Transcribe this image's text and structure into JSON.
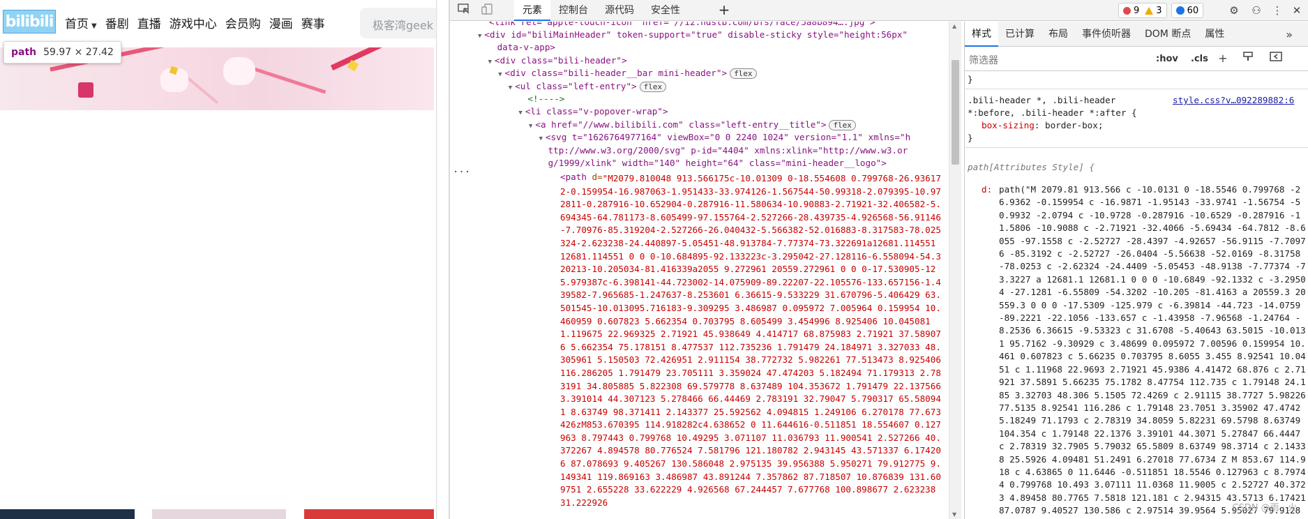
{
  "site": {
    "logo_text": "bilibili",
    "nav": [
      {
        "label": "首页",
        "has_dropdown": true
      },
      {
        "label": "番剧"
      },
      {
        "label": "直播"
      },
      {
        "label": "游戏中心"
      },
      {
        "label": "会员购"
      },
      {
        "label": "漫画"
      },
      {
        "label": "赛事"
      }
    ],
    "search_placeholder": "极客湾geek",
    "tooltip": {
      "tag": "path",
      "dims": "59.97 × 27.42"
    },
    "bottom_card_colors": [
      "#1e3046",
      "#f2e4ea",
      "#c8c8c8",
      "#e43b3b",
      "#f0d5c0"
    ]
  },
  "devtools": {
    "tabs": [
      "元素",
      "控制台",
      "源代码",
      "安全性"
    ],
    "active_tab": "元素",
    "errors": "9",
    "warnings": "3",
    "info": "60",
    "dom": {
      "top_fragment": "<link rel=\"apple-touch-icon\" href=\"//i2.hdslb.com/bfs/face/5a8b894….jpg\">",
      "lines": [
        {
          "indent": 0,
          "tri": "▼",
          "html": "<div id=\"biliMainHeader\" token-support=\"true\" disable-sticky style=\"height:56px\""
        },
        {
          "indent": 1,
          "tri": "",
          "html": "data-v-app>"
        },
        {
          "indent": 1,
          "tri": "▼",
          "html": "<div class=\"bili-header\">"
        },
        {
          "indent": 2,
          "tri": "▼",
          "html": "<div class=\"bili-header__bar mini-header\">",
          "badge": "flex"
        },
        {
          "indent": 3,
          "tri": "▼",
          "html": "<ul class=\"left-entry\">",
          "badge": "flex"
        },
        {
          "indent": 4,
          "tri": "",
          "html": "<!---->"
        },
        {
          "indent": 4,
          "tri": "▼",
          "html": "<li class=\"v-popover-wrap\">"
        },
        {
          "indent": 5,
          "tri": "▼",
          "html": "<a href=\"//www.bilibili.com\" class=\"left-entry__title\">",
          "badge": "flex"
        },
        {
          "indent": 6,
          "tri": "▼",
          "html": "<svg t=\"1626764977164\" viewBox=\"0 0 2240 1024\" version=\"1.1\" xmlns=\"h"
        },
        {
          "indent": 6,
          "tri": "",
          "html": "ttp://www.w3.org/2000/svg\" p-id=\"4404\" xmlns:xlink=\"http://www.w3.or"
        },
        {
          "indent": 6,
          "tri": "",
          "html": "g/1999/xlink\" width=\"140\" height=\"64\" class=\"mini-header__logo\">"
        }
      ],
      "path_tag": "<path",
      "path_attr": "d=",
      "path_value": "\"M2079.810048 913.566175c-10.01309 0-18.554608 0.799768-26.936172-0.159954-16.987063-1.951433-33.974126-1.567544-50.99318-2.079395-10.972811-0.287916-10.652904-0.287916-11.580634-10.90883-2.71921-32.406582-5.694345-64.781173-8.605499-97.155764-2.527266-28.439735-4.926568-56.91146-7.70976-85.319204-2.527266-26.040432-5.566382-52.016883-8.317583-78.025324-2.623238-24.440897-5.05451-48.913784-7.77374-73.322691a12681.114551 12681.114551 0 0 0-10.684895-92.133223c-3.295042-27.128116-6.558094-54.320213-10.205034-81.416339a2055 9.272961 20559.272961 0 0 0-17.530905-125.979387c-6.398141-44.723002-14.075909-89.22207-22.105576-133.657156-1.439582-7.965685-1.247637-8.253601 6.36615-9.533229 31.670796-5.406429 63.501545-10.013095.716183-9.309295 3.486987 0.095972 7.005964 0.159954 10.460959 0.607823 5.662354 0.703795 8.605499 3.454996 8.925406 10.045081 1.119675 22.969325 2.71921 45.938649 4.414717 68.875983 2.71921 37.589076 5.662354 75.178151 8.477537 112.735236 1.791479 24.184971 3.327033 48.305961 5.150503 72.426951 2.911154 38.772732 5.982261 77.513473 8.925406 116.286205 1.791479 23.705111 3.359024 47.474203 5.182494 71.179313 2.783191 34.805885 5.822308 69.579778 8.637489 104.353672 1.791479 22.137566 3.391014 44.307123 5.278466 66.44469 2.783191 32.79047 5.790317 65.580941 8.63749 98.371411 2.143377 25.592562 4.094815 1.249106 6.270178 77.673426zM853.670395 114.918282c4.638652 0 11.644616-0.511851 18.554607 0.127963 8.797443 0.799768 10.49295 3.071107 11.036793 11.900541 2.527266 40.372267 4.894578 80.776524 7.581796 121.180782 2.943145 43.571337 6.174206 87.078693 9.405267 130.586048 2.975135 39.956388 5.950271 79.912775 9.149341 119.869163 3.486987 43.891244 7.357862 87.718507 10.876839 131.609751 2.655228 33.622229 4.926568 67.244457 7.677768 100.898677 2.623238 31.222926"
    },
    "styles": {
      "tabs": [
        "样式",
        "已计算",
        "布局",
        "事件侦听器",
        "DOM 断点",
        "属性"
      ],
      "active_tab": "样式",
      "filter_placeholder": "筛选器",
      "hov": ":hov",
      "cls": ".cls",
      "close_brace": "}",
      "rule1_selector_a": ".bili-header *, .bili-header",
      "rule1_selector_b": "*:before, .bili-header *:after {",
      "rule1_source": "style.css?v…092289882:6",
      "rule1_prop": "box-sizing",
      "rule1_value": "border-box;",
      "rule2_selector": "path[Attributes Style] {",
      "d_key": "d:",
      "d_value": "path(\"M 2079.81 913.566 c -10.0131 0 -18.5546 0.799768 -26.9362 -0.159954 c -16.9871 -1.95143 -33.9741 -1.56754 -50.9932 -2.0794 c -10.9728 -0.287916 -10.6529 -0.287916 -11.5806 -10.9088 c -2.71921 -32.4066 -5.69434 -64.7812 -8.6055 -97.1558 c -2.52727 -28.4397 -4.92657 -56.9115 -7.70976 -85.3192 c -2.52727 -26.0404 -5.56638 -52.0169 -8.31758 -78.0253 c -2.62324 -24.4409 -5.05453 -48.9138 -7.77374 -73.3227 a 12681.1 12681.1 0 0 0 -10.6849 -92.1332 c -3.29504 -27.1281 -6.55809 -54.3202 -10.205 -81.4163 a 20559.3 20559.3 0 0 0 -17.5309 -125.979 c -6.39814 -44.723 -14.0759 -89.2221 -22.1056 -133.657 c -1.43958 -7.96568 -1.24764 -8.2536 6.36615 -9.53323 c 31.6708 -5.40643 63.5015 -10.0131 95.7162 -9.30929 c 3.48699 0.095972 7.00596 0.159954 10.461 0.607823 c 5.66235 0.703795 8.6055 3.455 8.92541 10.0451 c 1.11968 22.9693 2.71921 45.9386 4.41472 68.876 c 2.71921 37.5891 5.66235 75.1782 8.47754 112.735 c 1.79148 24.185 3.32703 48.306 5.1505 72.4269 c 2.91115 38.7727 5.98226 77.5135 8.92541 116.286 c 1.79148 23.7051 3.35902 47.4742 5.18249 71.1793 c 2.78319 34.8059 5.82231 69.5798 8.63749 104.354 c 1.79148 22.1376 3.39101 44.3071 5.27847 66.4447 c 2.78319 32.7905 5.79032 65.5809 8.63749 98.3714 c 2.14338 25.5926 4.09481 51.2491 6.27018 77.6734 Z M 853.67 114.918 c 4.63865 0 11.6446 -0.511851 18.5546 0.127963 c 8.79744 0.799768 10.493 3.07111 11.0368 11.9005 c 2.52727 40.3723 4.89458 80.7765 7.5818 121.181 c 2.94315 43.5713 6.17421 87.0787 9.40527 130.586 c 2.97514 39.9564 5.95027 79.9128 9.14934 119.869 c"
    }
  },
  "watermark": "CSDN @雨 · 火"
}
